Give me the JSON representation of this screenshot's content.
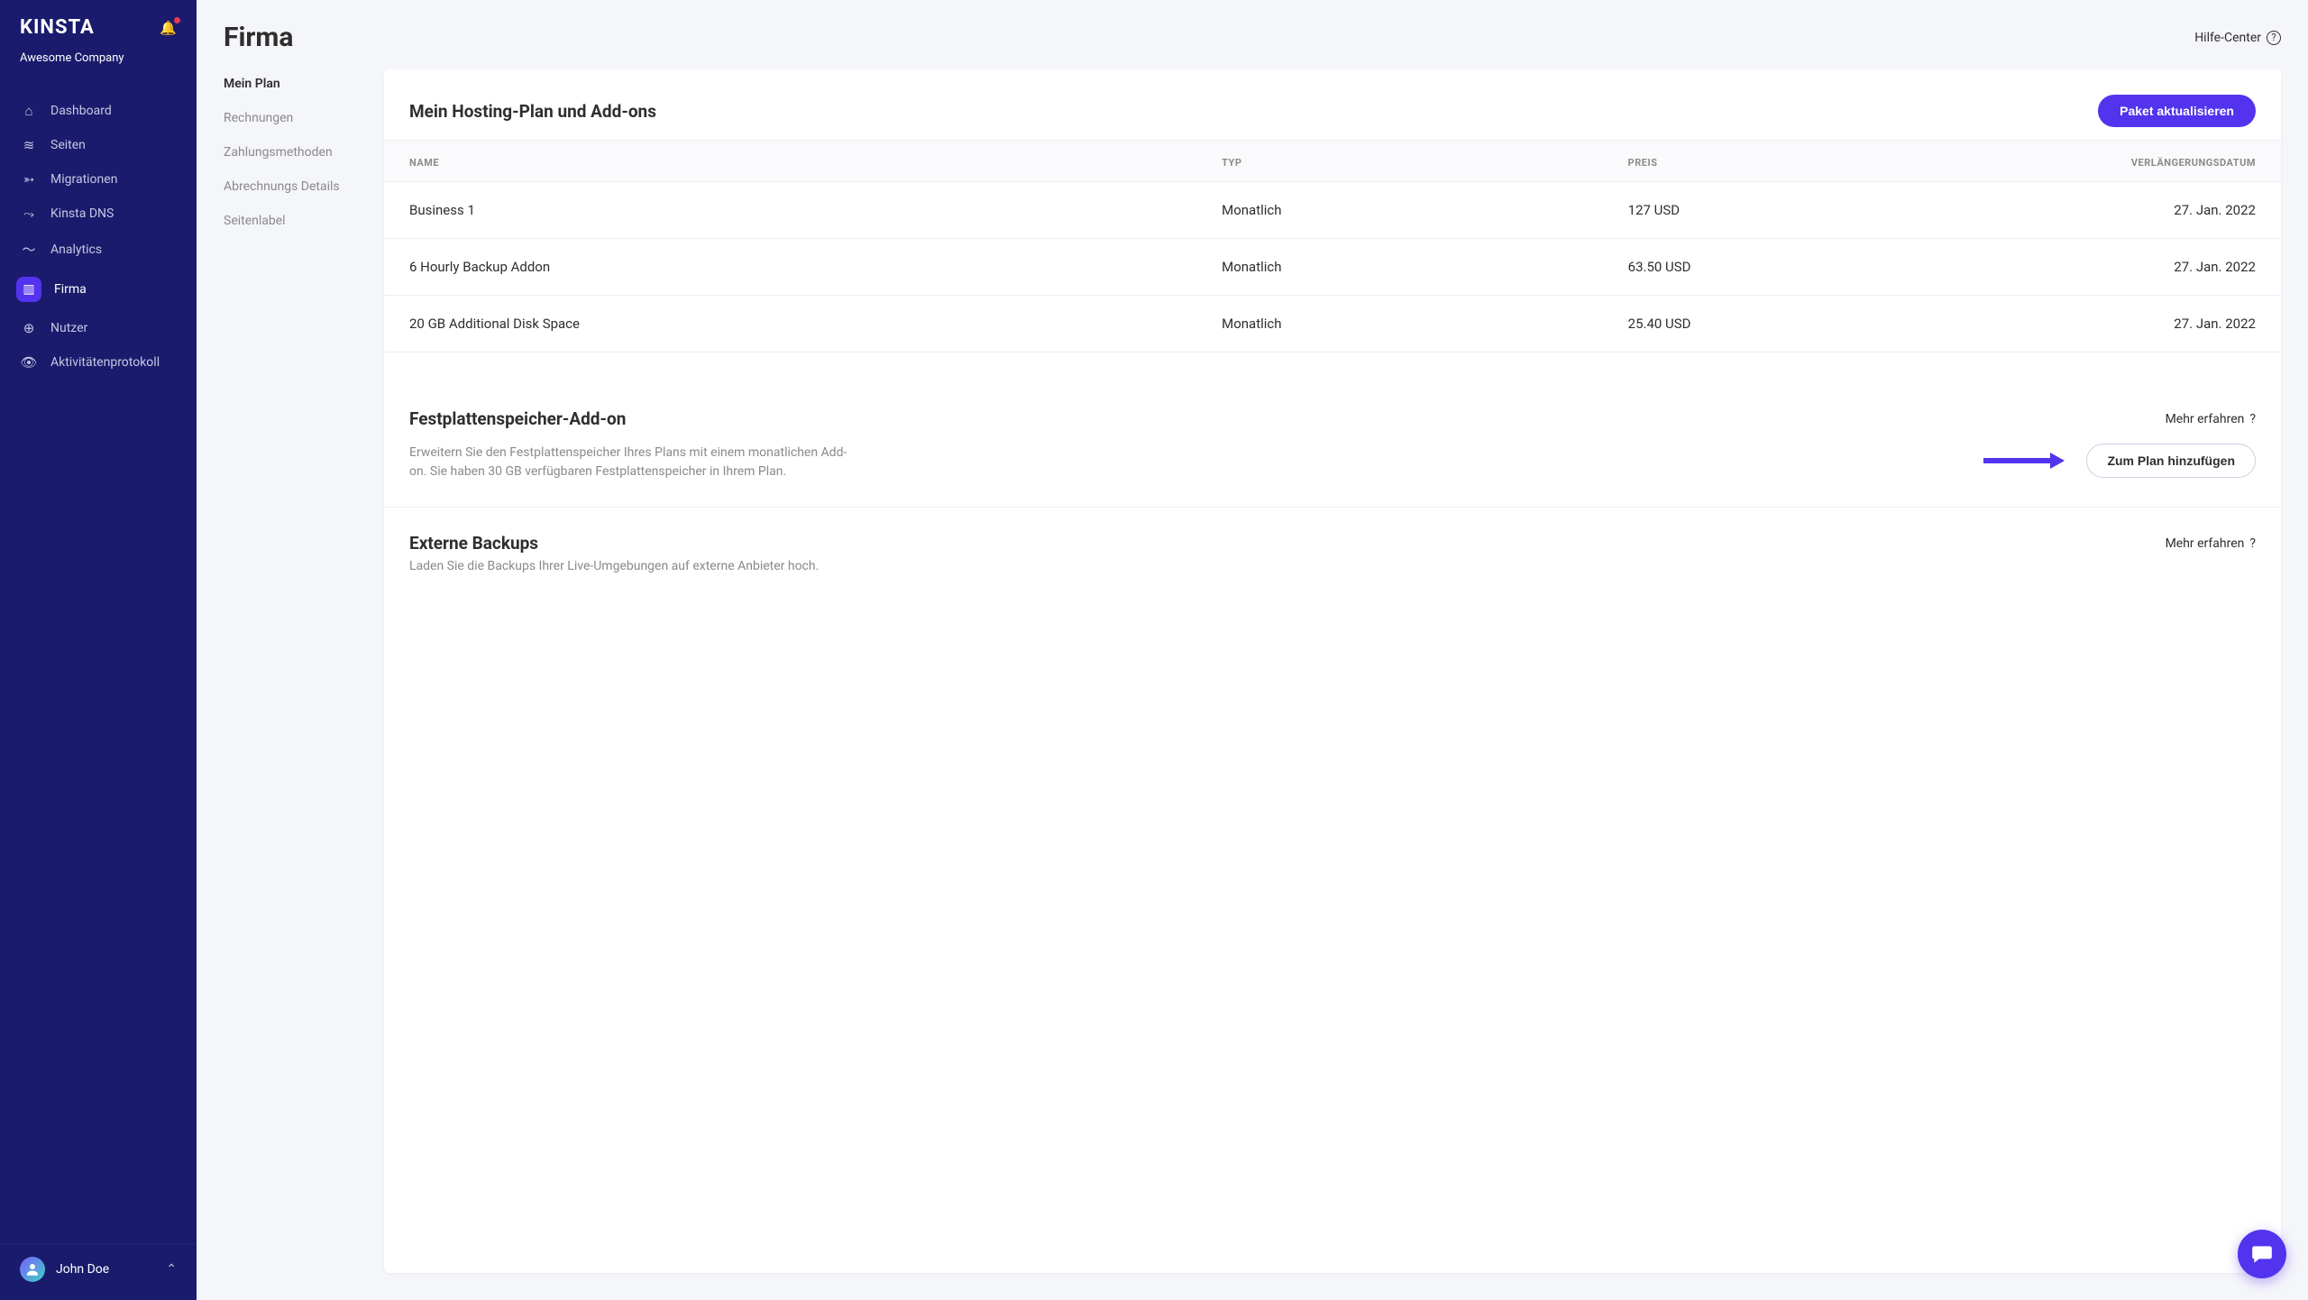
{
  "brand": "KINSTA",
  "company_name": "Awesome Company",
  "sidebar": {
    "items": [
      {
        "icon": "⌂",
        "label": "Dashboard",
        "name": "sidebar-item-dashboard"
      },
      {
        "icon": "≋",
        "label": "Seiten",
        "name": "sidebar-item-sites"
      },
      {
        "icon": "➳",
        "label": "Migrationen",
        "name": "sidebar-item-migrations"
      },
      {
        "icon": "⤳",
        "label": "Kinsta DNS",
        "name": "sidebar-item-dns"
      },
      {
        "icon": "〜",
        "label": "Analytics",
        "name": "sidebar-item-analytics"
      },
      {
        "icon": "▥",
        "label": "Firma",
        "name": "sidebar-item-company",
        "active": true
      },
      {
        "icon": "⊕",
        "label": "Nutzer",
        "name": "sidebar-item-users"
      },
      {
        "icon": "👁",
        "label": "Aktivitätenprotokoll",
        "name": "sidebar-item-activity"
      }
    ]
  },
  "user": {
    "name": "John Doe"
  },
  "page": {
    "title": "Firma",
    "help_label": "Hilfe-Center"
  },
  "subnav": [
    {
      "label": "Mein Plan",
      "name": "subnav-my-plan",
      "active": true
    },
    {
      "label": "Rechnungen",
      "name": "subnav-invoices"
    },
    {
      "label": "Zahlungsmethoden",
      "name": "subnav-payment"
    },
    {
      "label": "Abrechnungs Details",
      "name": "subnav-billing"
    },
    {
      "label": "Seitenlabel",
      "name": "subnav-sitelabels"
    }
  ],
  "plan_section": {
    "title": "Mein Hosting-Plan und Add-ons",
    "update_btn": "Paket aktualisieren",
    "columns": {
      "name": "NAME",
      "typ": "TYP",
      "preis": "PREIS",
      "datum": "VERLÄNGERUNGSDATUM"
    },
    "rows": [
      {
        "name": "Business 1",
        "typ": "Monatlich",
        "preis": "127 USD",
        "datum": "27. Jan. 2022"
      },
      {
        "name": "6 Hourly Backup Addon",
        "typ": "Monatlich",
        "preis": "63.50 USD",
        "datum": "27. Jan. 2022"
      },
      {
        "name": "20 GB Additional Disk Space",
        "typ": "Monatlich",
        "preis": "25.40 USD",
        "datum": "27. Jan. 2022"
      }
    ]
  },
  "disk_addon": {
    "title": "Festplattenspeicher-Add-on",
    "learn": "Mehr erfahren",
    "desc": "Erweitern Sie den Festplattenspeicher Ihres Plans mit einem monatlichen Add-on. Sie haben 30 GB verfügbaren Festplattenspeicher in Ihrem Plan.",
    "btn": "Zum Plan hinzufügen"
  },
  "ext_backups": {
    "title": "Externe Backups",
    "learn": "Mehr erfahren",
    "desc": "Laden Sie die Backups Ihrer Live-Umgebungen auf externe Anbieter hoch."
  }
}
